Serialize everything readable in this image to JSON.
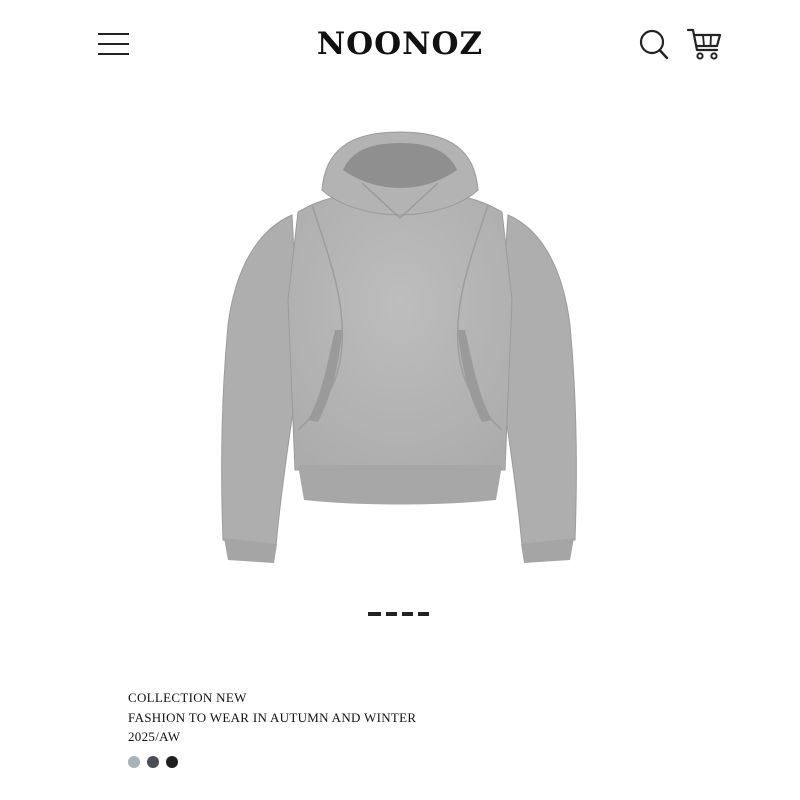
{
  "header": {
    "brand": "NOONOZ",
    "menu_icon": "hamburger-menu-icon",
    "search_icon": "search-icon",
    "cart_icon": "shopping-cart-icon"
  },
  "hero": {
    "product_image": "gray-hoodie-image",
    "pager": {
      "count": 4,
      "active_index": 0
    }
  },
  "info": {
    "line1": "COLLECTION NEW",
    "line2": "FASHION TO WEAR IN AUTUMN AND WINTER",
    "line3": "2025/AW"
  },
  "swatches": [
    {
      "color": "#a9b2b8"
    },
    {
      "color": "#4a4f56"
    },
    {
      "color": "#1f1f1f"
    }
  ]
}
